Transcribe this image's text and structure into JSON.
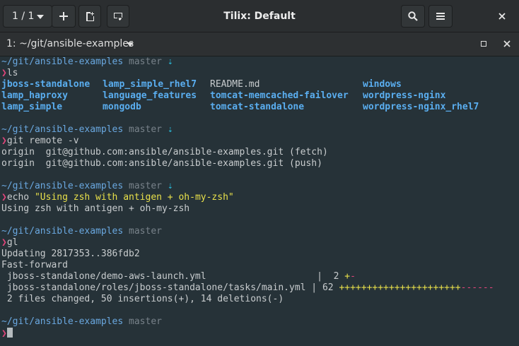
{
  "window": {
    "session_label": "1 / 1",
    "title": "Tilix: Default"
  },
  "tab": {
    "title": "1: ~/git/ansible-examples"
  },
  "prompt": {
    "path": "~/git/ansible-examples",
    "branch": "master",
    "behind_arrow": "⇣",
    "symbol": "❯"
  },
  "commands": {
    "c1": "ls",
    "c2": "git remote -v",
    "c3_cmd": "echo ",
    "c3_str": "\"Using zsh with antigen + oh-my-zsh\"",
    "c4": "gl"
  },
  "ls_output": {
    "r1c1": "jboss-standalone",
    "r1c2": "lamp_simple_rhel7",
    "r1c3": "README.md",
    "r1c4": "windows",
    "r2c1": "lamp_haproxy",
    "r2c2": "language_features",
    "r2c3": "tomcat-memcached-failover",
    "r2c4": "wordpress-nginx",
    "r3c1": "lamp_simple",
    "r3c2": "mongodb",
    "r3c3": "tomcat-standalone",
    "r3c4": "wordpress-nginx_rhel7"
  },
  "remote_output": {
    "fetch": "origin  git@github.com:ansible/ansible-examples.git (fetch)",
    "push": "origin  git@github.com:ansible/ansible-examples.git (push)"
  },
  "echo_output": "Using zsh with antigen + oh-my-zsh",
  "pull_output": {
    "updating": "Updating 2817353..386fdb2",
    "fast_forward": "Fast-forward",
    "file1": " jboss-standalone/demo-aws-launch.yml                    |  2 ",
    "file1_plus": "+",
    "file1_minus": "-",
    "file2": " jboss-standalone/roles/jboss-standalone/tasks/main.yml | 62 ",
    "file2_plus": "++++++++++++++++++++++",
    "file2_minus": "------",
    "summary": " 2 files changed, 50 insertions(+), 14 deletions(-)"
  }
}
